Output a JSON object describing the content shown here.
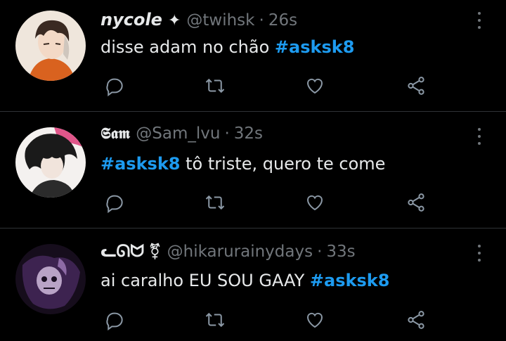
{
  "tweets": [
    {
      "name": "nycole",
      "badge": "✦",
      "handle": "@twihsk",
      "sep": "·",
      "time": "26s",
      "text_before": "disse adam no chão ",
      "hashtag": "#asksk8",
      "text_after": ""
    },
    {
      "name": "𝕾𝖆𝖒",
      "badge": "",
      "handle": "@Sam_lvu",
      "sep": "·",
      "time": "32s",
      "text_before": "",
      "hashtag": "#asksk8",
      "text_after": " tô triste, quero te come"
    },
    {
      "name": "ᓚᘏᗢ",
      "badge": "⚧",
      "handle": "@hikarurainydays",
      "sep": "·",
      "time": "33s",
      "text_before": "ai caralho EU SOU GAAY ",
      "hashtag": "#asksk8",
      "text_after": ""
    }
  ],
  "colors": {
    "background": "#000000",
    "text": "#e7e9ea",
    "muted": "#71767b",
    "hashtag": "#1d9bf0",
    "divider": "#2f3336"
  },
  "icons": [
    "reply-icon",
    "retweet-icon",
    "like-icon",
    "share-icon",
    "more-icon"
  ]
}
